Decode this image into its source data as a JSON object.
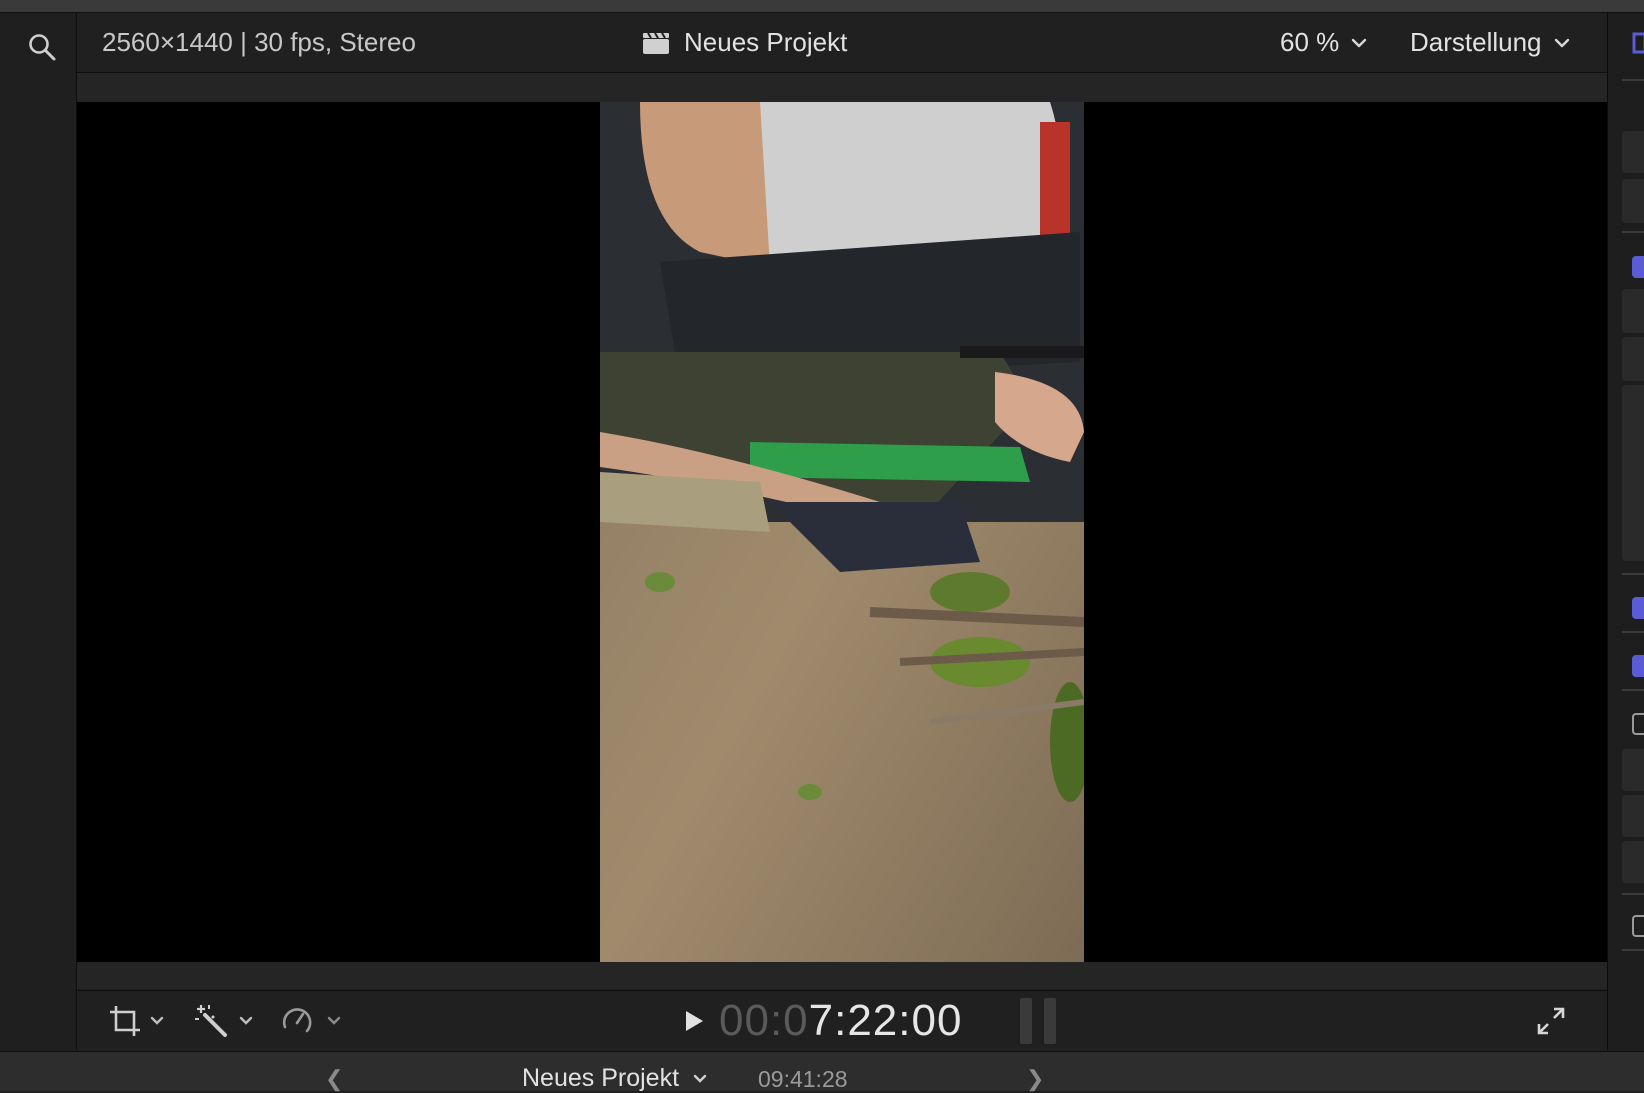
{
  "header": {
    "format": "2560×1440 | 30 fps, Stereo",
    "project_title": "Neues Projekt",
    "zoom": "60 %",
    "view_menu": "Darstellung"
  },
  "viewer": {
    "media": "vertical video frame"
  },
  "controls": {
    "timecode_dim": "00:0",
    "timecode_main": "7:22:00"
  },
  "timeline_bar": {
    "project_title": "Neues Projekt",
    "duration": "09:41:28"
  },
  "icons": {
    "search": "search-icon",
    "clapper": "clapperboard-icon",
    "transform": "transform-icon",
    "enhance": "magic-wand-icon",
    "retime": "speedometer-icon",
    "play": "play-icon",
    "fullscreen": "fullscreen-icon"
  },
  "colors": {
    "accent": "#5b5bd6",
    "background": "#1f1f1f"
  }
}
